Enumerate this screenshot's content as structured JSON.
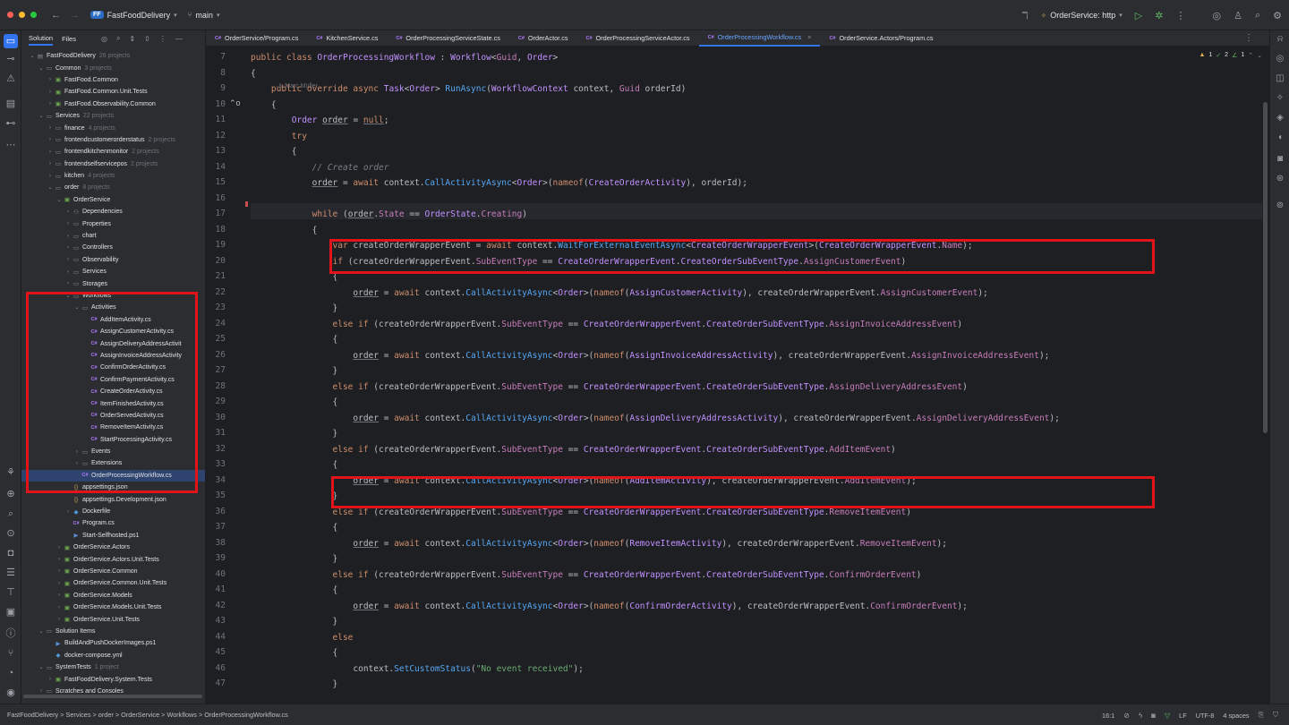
{
  "titlebar": {
    "project_badge": "FF",
    "project_name": "FastFoodDelivery",
    "branch": "main",
    "run_config": "OrderService: http"
  },
  "project_panel": {
    "tab_solution": "Solution",
    "tab_files": "Files",
    "tree": [
      {
        "label": "FastFoodDelivery",
        "meta": "26 projects",
        "level": 0,
        "kind": "sln",
        "open": true
      },
      {
        "label": "Common",
        "meta": "3 projects",
        "level": 1,
        "kind": "folder",
        "open": true
      },
      {
        "label": "FastFood.Common",
        "meta": "",
        "level": 2,
        "kind": "proj",
        "open": false
      },
      {
        "label": "FastFood.Common.Unit.Tests",
        "meta": "",
        "level": 2,
        "kind": "proj",
        "open": false
      },
      {
        "label": "FastFood.Observability.Common",
        "meta": "",
        "level": 2,
        "kind": "proj",
        "open": false
      },
      {
        "label": "Services",
        "meta": "22 projects",
        "level": 1,
        "kind": "folder",
        "open": true
      },
      {
        "label": "finance",
        "meta": "4 projects",
        "level": 2,
        "kind": "folder",
        "open": false
      },
      {
        "label": "frontendcustomerorderstatus",
        "meta": "2 projects",
        "level": 2,
        "kind": "folder",
        "open": false
      },
      {
        "label": "frontendkitchenmonitor",
        "meta": "2 projects",
        "level": 2,
        "kind": "folder",
        "open": false
      },
      {
        "label": "frontendselfservicepos",
        "meta": "2 projects",
        "level": 2,
        "kind": "folder",
        "open": false
      },
      {
        "label": "kitchen",
        "meta": "4 projects",
        "level": 2,
        "kind": "folder",
        "open": false
      },
      {
        "label": "order",
        "meta": "8 projects",
        "level": 2,
        "kind": "folder",
        "open": true
      },
      {
        "label": "OrderService",
        "meta": "",
        "level": 3,
        "kind": "proj",
        "open": true
      },
      {
        "label": "Dependencies",
        "meta": "",
        "level": 4,
        "kind": "dep",
        "open": false
      },
      {
        "label": "Properties",
        "meta": "",
        "level": 4,
        "kind": "folder",
        "open": false
      },
      {
        "label": "chart",
        "meta": "",
        "level": 4,
        "kind": "folder",
        "open": false
      },
      {
        "label": "Controllers",
        "meta": "",
        "level": 4,
        "kind": "folder",
        "open": false
      },
      {
        "label": "Observability",
        "meta": "",
        "level": 4,
        "kind": "folder",
        "open": false
      },
      {
        "label": "Services",
        "meta": "",
        "level": 4,
        "kind": "folder",
        "open": false
      },
      {
        "label": "Storages",
        "meta": "",
        "level": 4,
        "kind": "folder",
        "open": false
      },
      {
        "label": "Workflows",
        "meta": "",
        "level": 4,
        "kind": "folder",
        "open": true
      },
      {
        "label": "Activities",
        "meta": "",
        "level": 5,
        "kind": "folder",
        "open": true
      },
      {
        "label": "AddItemActivity.cs",
        "meta": "",
        "level": 6,
        "kind": "cs"
      },
      {
        "label": "AssignCustomerActivity.cs",
        "meta": "",
        "level": 6,
        "kind": "cs"
      },
      {
        "label": "AssignDeliveryAddressActivit",
        "meta": "",
        "level": 6,
        "kind": "cs"
      },
      {
        "label": "AssignInvoiceAddressActivity",
        "meta": "",
        "level": 6,
        "kind": "cs"
      },
      {
        "label": "ConfirmOrderActivity.cs",
        "meta": "",
        "level": 6,
        "kind": "cs"
      },
      {
        "label": "ConfirmPaymentActivity.cs",
        "meta": "",
        "level": 6,
        "kind": "cs"
      },
      {
        "label": "CreateOrderActivity.cs",
        "meta": "",
        "level": 6,
        "kind": "cs"
      },
      {
        "label": "ItemFinishedActivity.cs",
        "meta": "",
        "level": 6,
        "kind": "cs"
      },
      {
        "label": "OrderServedActivity.cs",
        "meta": "",
        "level": 6,
        "kind": "cs"
      },
      {
        "label": "RemoveItemActivity.cs",
        "meta": "",
        "level": 6,
        "kind": "cs"
      },
      {
        "label": "StartProcessingActivity.cs",
        "meta": "",
        "level": 6,
        "kind": "cs"
      },
      {
        "label": "Events",
        "meta": "",
        "level": 5,
        "kind": "folder",
        "open": false
      },
      {
        "label": "Extensions",
        "meta": "",
        "level": 5,
        "kind": "folder",
        "open": false
      },
      {
        "label": "OrderProcessingWorkflow.cs",
        "meta": "",
        "level": 5,
        "kind": "cs",
        "selected": true
      },
      {
        "label": "appsettings.json",
        "meta": "",
        "level": 4,
        "kind": "json"
      },
      {
        "label": "appsettings.Development.json",
        "meta": "",
        "level": 4,
        "kind": "json"
      },
      {
        "label": "Dockerfile",
        "meta": "",
        "level": 4,
        "kind": "docker",
        "open": false
      },
      {
        "label": "Program.cs",
        "meta": "",
        "level": 4,
        "kind": "cs"
      },
      {
        "label": "Start-Selfhosted.ps1",
        "meta": "",
        "level": 4,
        "kind": "ps"
      },
      {
        "label": "OrderService.Actors",
        "meta": "",
        "level": 3,
        "kind": "proj",
        "open": false
      },
      {
        "label": "OrderService.Actors.Unit.Tests",
        "meta": "",
        "level": 3,
        "kind": "proj",
        "open": false
      },
      {
        "label": "OrderService.Common",
        "meta": "",
        "level": 3,
        "kind": "proj",
        "open": false
      },
      {
        "label": "OrderService.Common.Unit.Tests",
        "meta": "",
        "level": 3,
        "kind": "proj",
        "open": false
      },
      {
        "label": "OrderService.Models",
        "meta": "",
        "level": 3,
        "kind": "proj",
        "open": false
      },
      {
        "label": "OrderService.Models.Unit.Tests",
        "meta": "",
        "level": 3,
        "kind": "proj",
        "open": false
      },
      {
        "label": "OrderService.Unit.Tests",
        "meta": "",
        "level": 3,
        "kind": "proj",
        "open": false
      },
      {
        "label": "Solution Items",
        "meta": "",
        "level": 1,
        "kind": "folder",
        "open": true
      },
      {
        "label": "BuildAndPushDockerImages.ps1",
        "meta": "",
        "level": 2,
        "kind": "ps"
      },
      {
        "label": "docker-compose.yml",
        "meta": "",
        "level": 2,
        "kind": "docker"
      },
      {
        "label": "SystemTests",
        "meta": "1 project",
        "level": 1,
        "kind": "folder",
        "open": true
      },
      {
        "label": "FastFoodDelivery.System.Tests",
        "meta": "",
        "level": 2,
        "kind": "proj",
        "open": false
      },
      {
        "label": "Scratches and Consoles",
        "meta": "",
        "level": 1,
        "kind": "folder",
        "open": false
      }
    ]
  },
  "tabs": [
    {
      "label": "OrderService/Program.cs",
      "active": false
    },
    {
      "label": "KitchenService.cs",
      "active": false
    },
    {
      "label": "OrderProcessingServiceState.cs",
      "active": false
    },
    {
      "label": "OrderActor.cs",
      "active": false
    },
    {
      "label": "OrderProcessingServiceActor.cs",
      "active": false
    },
    {
      "label": "OrderProcessingWorkflow.cs",
      "active": true
    },
    {
      "label": "OrderService.Actors/Program.cs",
      "active": false
    }
  ],
  "editor": {
    "author": "Marc Müller",
    "inspections": {
      "warnings": "1",
      "weak": "2",
      "typos": "1"
    },
    "line_numbers": [
      "7",
      "8",
      "9",
      "10",
      "11",
      "12",
      "13",
      "14",
      "15",
      "16",
      "17",
      "18",
      "19",
      "20",
      "21",
      "22",
      "23",
      "24",
      "25",
      "26",
      "27",
      "28",
      "29",
      "30",
      "31",
      "32",
      "33",
      "34",
      "35",
      "36",
      "37",
      "38",
      "39",
      "40",
      "41",
      "42",
      "43",
      "44",
      "45",
      "46",
      "47"
    ]
  },
  "statusbar": {
    "breadcrumb": "FastFoodDelivery > Services > order > OrderService > Workflows > OrderProcessingWorkflow.cs",
    "position": "16:1",
    "line_sep": "LF",
    "encoding": "UTF-8",
    "indent": "4 spaces"
  },
  "colors": {
    "highlight_box": "#e2141a",
    "accent": "#3574f0",
    "background": "#1e1f22"
  }
}
